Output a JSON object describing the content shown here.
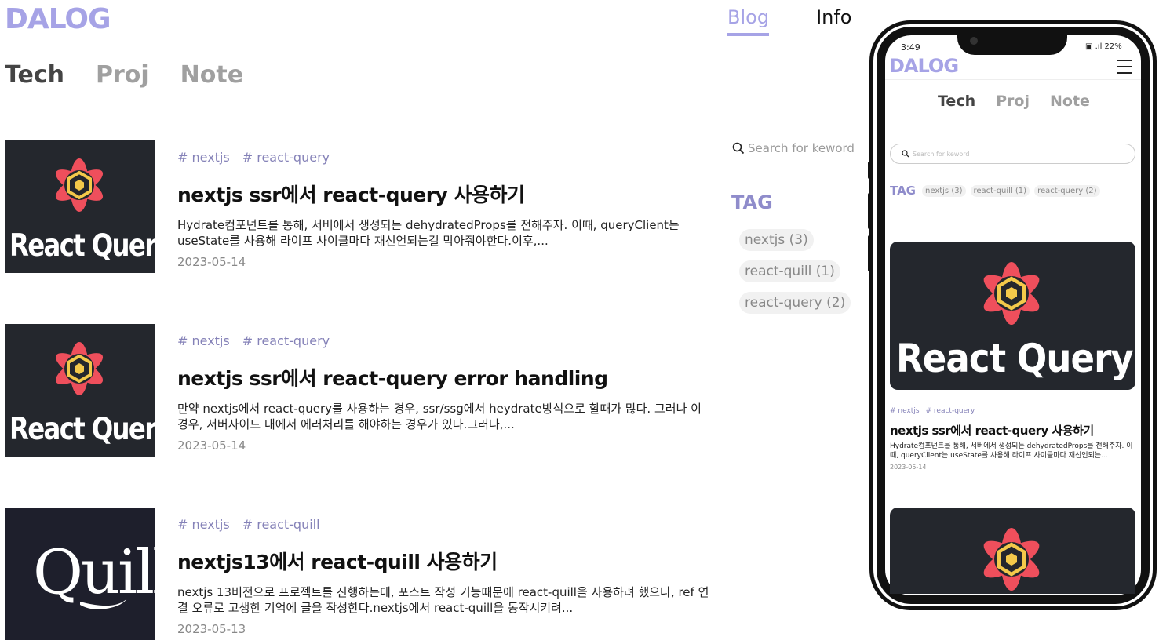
{
  "brand": {
    "logo": "DALOG",
    "accent": "#a6a3e6",
    "tag_color": "#8f8ccb"
  },
  "topnav": {
    "blog": "Blog",
    "info": "Info"
  },
  "categories": {
    "tech": "Tech",
    "proj": "Proj",
    "note": "Note"
  },
  "posts": [
    {
      "tags": [
        "# nextjs",
        "# react-query"
      ],
      "title": "nextjs ssr에서 react-query 사용하기",
      "excerpt": "Hydrate컴포넌트를 통해, 서버에서 생성되는 dehydratedProps를 전해주자. 이때, queryClient는 useState를 사용해 라이프 사이클마다 재선언되는걸 막아줘야한다.이후,...",
      "date": "2023-05-14",
      "thumb_text": "React Query"
    },
    {
      "tags": [
        "# nextjs",
        "# react-query"
      ],
      "title": "nextjs ssr에서 react-query error handling",
      "excerpt": "만약 nextjs에서 react-query를 사용하는 경우, ssr/ssg에서 heydrate방식으로 할때가 많다. 그러나 이 경우, 서버사이드 내에서 에러처리를 해야하는 경우가 있다.그러나,...",
      "date": "2023-05-14",
      "thumb_text": "React Query"
    },
    {
      "tags": [
        "# nextjs",
        "# react-quill"
      ],
      "title": "nextjs13에서 react-quill 사용하기",
      "excerpt": "nextjs 13버전으로 프로젝트를 진행하는데, 포스트 작성 기능때문에 react-quill을 사용하려 했으나, ref 연결 오류로 고생한 기억에 글을 작성한다.nextjs에서 react-quill을 동작시키려...",
      "date": "2023-05-13",
      "thumb_text": "Quill"
    }
  ],
  "sidebar": {
    "search_placeholder": "Search for keword",
    "tag_heading": "TAG",
    "tags": [
      "nextjs (3)",
      "react-quill (1)",
      "react-query (2)"
    ]
  },
  "phone": {
    "time": "3:49",
    "status": "▣ .ıl 22%",
    "logo": "DALOG",
    "categories": {
      "tech": "Tech",
      "proj": "Proj",
      "note": "Note"
    },
    "search_placeholder": "Search for keword",
    "tag_heading": "TAG",
    "tags": [
      "nextjs (3)",
      "react-quill (1)",
      "react-query (2)"
    ],
    "post": {
      "thumb_text": "React Query",
      "tags": [
        "# nextjs",
        "# react-query"
      ],
      "title": "nextjs ssr에서 react-query 사용하기",
      "excerpt": "Hydrate컴포넌트를 통해, 서버에서 생성되는 dehydratedProps를 전해주자. 이때, queryClient는 useState를 사용해 라이프 사이클마다 재선언되는...",
      "date": "2023-05-14"
    }
  }
}
